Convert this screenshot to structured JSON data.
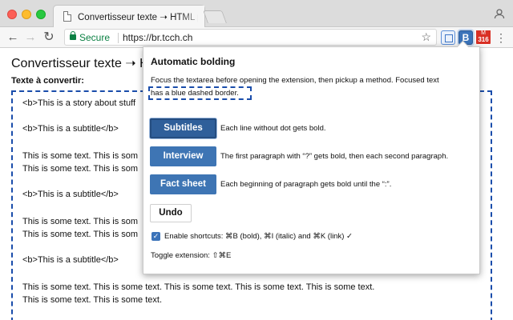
{
  "browser": {
    "tab_title": "Convertisseur texte ➝ HTML p",
    "secure_label": "Secure",
    "url": "https://br.tcch.ch",
    "gmail_badge": "316",
    "gmail_label": "M"
  },
  "page": {
    "title": "Convertisseur texte ➝ H",
    "field_label": "Texte à convertir:",
    "textarea_lines": [
      "<b>This is a story about stuff",
      "<b>This is a subtitle</b>",
      "This is some text. This is som",
      "This is some text. This is som",
      "<b>This is a subtitle</b>",
      "This is some text. This is som",
      "This is some text. This is som",
      "<b>This is a subtitle</b>",
      "This is some text. This is some text. This is some text. This is some text. This is some text.",
      "This is some text. This is some text."
    ]
  },
  "popup": {
    "title": "Automatic bolding",
    "description_line1": "Focus the textarea before opening the extension, then pickup a method. Focused text",
    "description_line2": "has a blue dashed border.",
    "methods": [
      {
        "label": "Subtitles",
        "description": "Each line without dot gets bold."
      },
      {
        "label": "Interview",
        "description": "The first paragraph with “?” gets bold, then each second paragraph."
      },
      {
        "label": "Fact sheet",
        "description": "Each beginning of paragraph gets bold until the “:”."
      }
    ],
    "undo_label": "Undo",
    "shortcuts_label": "Enable shortcuts: ⌘B (bold), ⌘I (italic) and ⌘K (link)  ✓",
    "toggle_label": "Toggle extension: ⇧⌘E"
  },
  "colors": {
    "accent": "#3e75b4",
    "focus_border": "#1a4dab",
    "secure_green": "#0b8043"
  }
}
